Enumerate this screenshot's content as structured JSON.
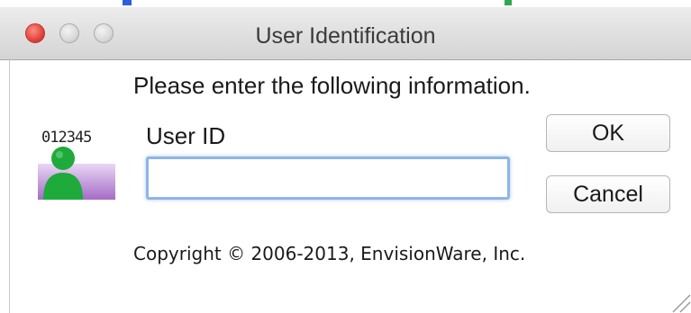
{
  "window": {
    "title": "User Identification"
  },
  "dialog": {
    "instruction": "Please enter the following information.",
    "badge_number": "012345",
    "user_id_label": "User ID",
    "user_id_value": "",
    "user_id_placeholder": "",
    "ok_label": "OK",
    "cancel_label": "Cancel",
    "copyright": "Copyright © 2006-2013,  EnvisionWare, Inc."
  },
  "colors": {
    "close_button": "#e0443b",
    "input_focus_ring": "#8fb5e8",
    "avatar_green": "#1faa3c",
    "avatar_background": "#b57fd1"
  },
  "icons": {
    "traffic_lights": [
      "close-icon",
      "minimize-icon",
      "zoom-icon"
    ],
    "avatar": "user-id-badge-icon",
    "resize": "resize-grip-icon"
  }
}
